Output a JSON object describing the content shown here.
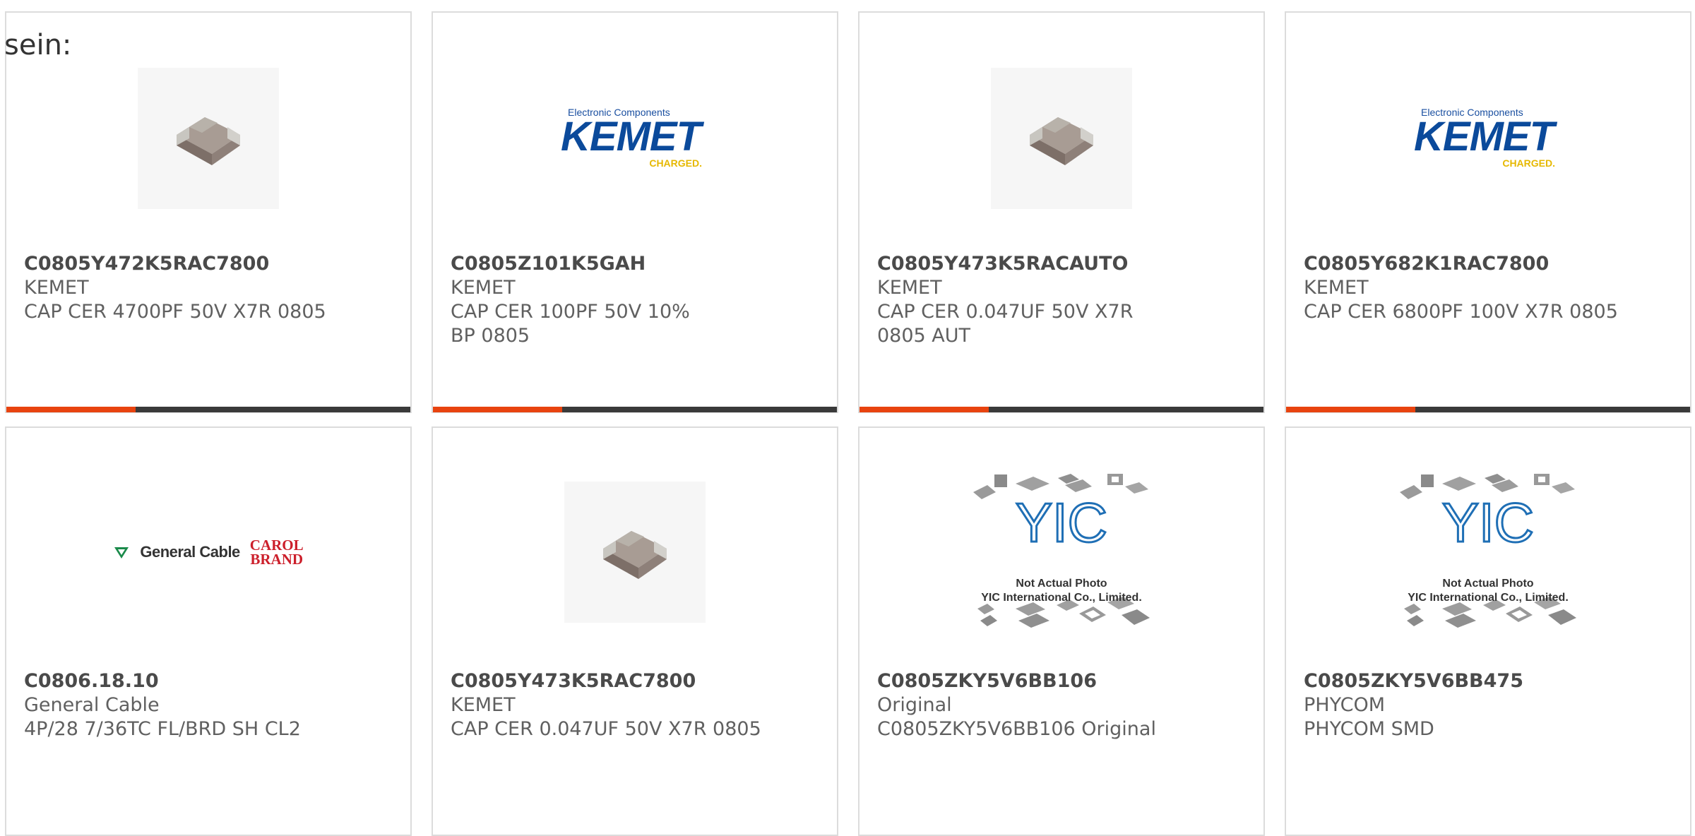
{
  "intro_text": "sein:",
  "kemet_logo": {
    "top": "Electronic Components",
    "brand": "KEMET",
    "tag": "CHARGED."
  },
  "general_cable_logo": {
    "name": "General Cable",
    "carol_line1": "CAROL",
    "carol_line2": "BRAND"
  },
  "yic_logo": {
    "brand": "YIC",
    "line1": "Not Actual Photo",
    "line2": "YIC International Co., Limited."
  },
  "products": [
    {
      "part_number": "C0805Y472K5RAC7800",
      "manufacturer": "KEMET",
      "description": "CAP CER 4700PF 50V X7R 0805",
      "image": "capacitor-photo"
    },
    {
      "part_number": "C0805Z101K5GAH",
      "manufacturer": "KEMET",
      "description": "CAP CER 100PF 50V 10% BP 0805",
      "image": "kemet-logo"
    },
    {
      "part_number": "C0805Y473K5RACAUTO",
      "manufacturer": "KEMET",
      "description": "CAP CER 0.047UF 50V X7R 0805 AUT",
      "image": "capacitor-photo"
    },
    {
      "part_number": "C0805Y682K1RAC7800",
      "manufacturer": "KEMET",
      "description": "CAP CER 6800PF 100V X7R 0805",
      "image": "kemet-logo"
    },
    {
      "part_number": "C0806.18.10",
      "manufacturer": "General Cable",
      "description": "4P/28 7/36TC FL/BRD SH CL2",
      "image": "general-cable-logo"
    },
    {
      "part_number": "C0805Y473K5RAC7800",
      "manufacturer": "KEMET",
      "description": "CAP CER 0.047UF 50V X7R 0805",
      "image": "capacitor-photo"
    },
    {
      "part_number": "C0805ZKY5V6BB106",
      "manufacturer": "Original",
      "description": "C0805ZKY5V6BB106 Original",
      "image": "yic-placeholder"
    },
    {
      "part_number": "C0805ZKY5V6BB475",
      "manufacturer": "PHYCOM",
      "description": "PHYCOM SMD",
      "image": "yic-placeholder"
    }
  ],
  "colors": {
    "accent": "#e8430f",
    "bar": "#3a3a3a",
    "border": "#dcdcdc"
  }
}
